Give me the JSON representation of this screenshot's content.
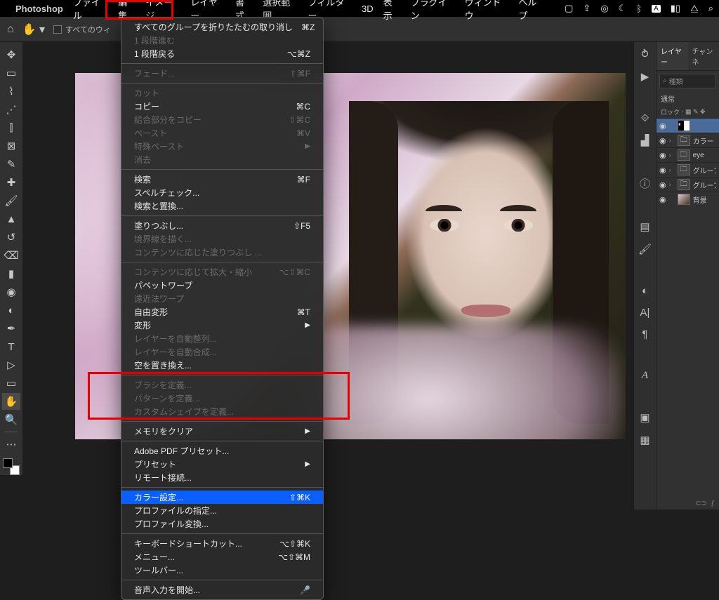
{
  "menubar": {
    "app": "Photoshop",
    "items": [
      "ファイル",
      "編集",
      "イメージ",
      "レイヤー",
      "書式",
      "選択範囲",
      "フィルター",
      "3D",
      "表示",
      "プラグイン",
      "ウィンドウ",
      "ヘルプ"
    ]
  },
  "optbar": {
    "checkbox_label": "すべてのウィ"
  },
  "edit_menu": [
    {
      "t": "item",
      "label": "すべてのグループを折りたたむの取り消し",
      "sc": "⌘Z"
    },
    {
      "t": "item",
      "label": "1 段階進む",
      "dis": true
    },
    {
      "t": "item",
      "label": "1 段階戻る",
      "sc": "⌥⌘Z"
    },
    {
      "t": "sep"
    },
    {
      "t": "item",
      "label": "フェード...",
      "sc": "⇧⌘F",
      "dis": true
    },
    {
      "t": "sep"
    },
    {
      "t": "item",
      "label": "カット",
      "dis": true
    },
    {
      "t": "item",
      "label": "コピー",
      "sc": "⌘C"
    },
    {
      "t": "item",
      "label": "結合部分をコピー",
      "sc": "⇧⌘C",
      "dis": true
    },
    {
      "t": "item",
      "label": "ペースト",
      "sc": "⌘V",
      "dis": true
    },
    {
      "t": "item",
      "label": "特殊ペースト",
      "sub": true,
      "dis": true
    },
    {
      "t": "item",
      "label": "消去",
      "dis": true
    },
    {
      "t": "sep"
    },
    {
      "t": "item",
      "label": "検索",
      "sc": "⌘F"
    },
    {
      "t": "item",
      "label": "スペルチェック..."
    },
    {
      "t": "item",
      "label": "検索と置換..."
    },
    {
      "t": "sep"
    },
    {
      "t": "item",
      "label": "塗りつぶし...",
      "sc": "⇧F5"
    },
    {
      "t": "item",
      "label": "境界線を描く...",
      "dis": true
    },
    {
      "t": "item",
      "label": "コンテンツに応じた塗りつぶし ...",
      "dis": true
    },
    {
      "t": "sep"
    },
    {
      "t": "item",
      "label": "コンテンツに応じて拡大・縮小",
      "sc": "⌥⇧⌘C",
      "dis": true
    },
    {
      "t": "item",
      "label": "パペットワープ"
    },
    {
      "t": "item",
      "label": "遠近法ワープ",
      "dis": true
    },
    {
      "t": "item",
      "label": "自由変形",
      "sc": "⌘T"
    },
    {
      "t": "item",
      "label": "変形",
      "sub": true
    },
    {
      "t": "item",
      "label": "レイヤーを自動整列...",
      "dis": true
    },
    {
      "t": "item",
      "label": "レイヤーを自動合成...",
      "dis": true
    },
    {
      "t": "item",
      "label": "空を置き換え..."
    },
    {
      "t": "sep"
    },
    {
      "t": "item",
      "label": "ブラシを定義...",
      "dis": true
    },
    {
      "t": "item",
      "label": "パターンを定義...",
      "dis": true
    },
    {
      "t": "item",
      "label": "カスタムシェイプを定義...",
      "dis": true
    },
    {
      "t": "sep"
    },
    {
      "t": "item",
      "label": "メモリをクリア",
      "sub": true
    },
    {
      "t": "sep"
    },
    {
      "t": "item",
      "label": "Adobe PDF プリセット..."
    },
    {
      "t": "item",
      "label": "プリセット",
      "sub": true
    },
    {
      "t": "item",
      "label": "リモート接続..."
    },
    {
      "t": "sep"
    },
    {
      "t": "item",
      "label": "カラー設定...",
      "sc": "⇧⌘K",
      "sel": true
    },
    {
      "t": "item",
      "label": "プロファイルの指定..."
    },
    {
      "t": "item",
      "label": "プロファイル変換..."
    },
    {
      "t": "sep"
    },
    {
      "t": "item",
      "label": "キーボードショートカット...",
      "sc": "⌥⇧⌘K"
    },
    {
      "t": "item",
      "label": "メニュー...",
      "sc": "⌥⇧⌘M"
    },
    {
      "t": "item",
      "label": "ツールバー..."
    },
    {
      "t": "sep"
    },
    {
      "t": "item",
      "label": "音声入力を開始...",
      "mic": true
    }
  ],
  "layers_panel": {
    "tabs": [
      "レイヤー",
      "チャンネ"
    ],
    "search_placeholder": "種類",
    "blend": "通常",
    "lock_label": "ロック :",
    "layers": [
      {
        "eye": true,
        "caret": "",
        "thumb": "adj",
        "name": ""
      },
      {
        "eye": true,
        "caret": "›",
        "thumb": "fold",
        "name": "カラー"
      },
      {
        "eye": true,
        "caret": "›",
        "thumb": "fold",
        "name": "eye"
      },
      {
        "eye": true,
        "caret": "›",
        "thumb": "fold",
        "name": "グループ"
      },
      {
        "eye": true,
        "caret": "›",
        "thumb": "fold",
        "name": "グループ"
      },
      {
        "eye": true,
        "caret": "",
        "thumb": "img",
        "name": "背景"
      }
    ]
  }
}
